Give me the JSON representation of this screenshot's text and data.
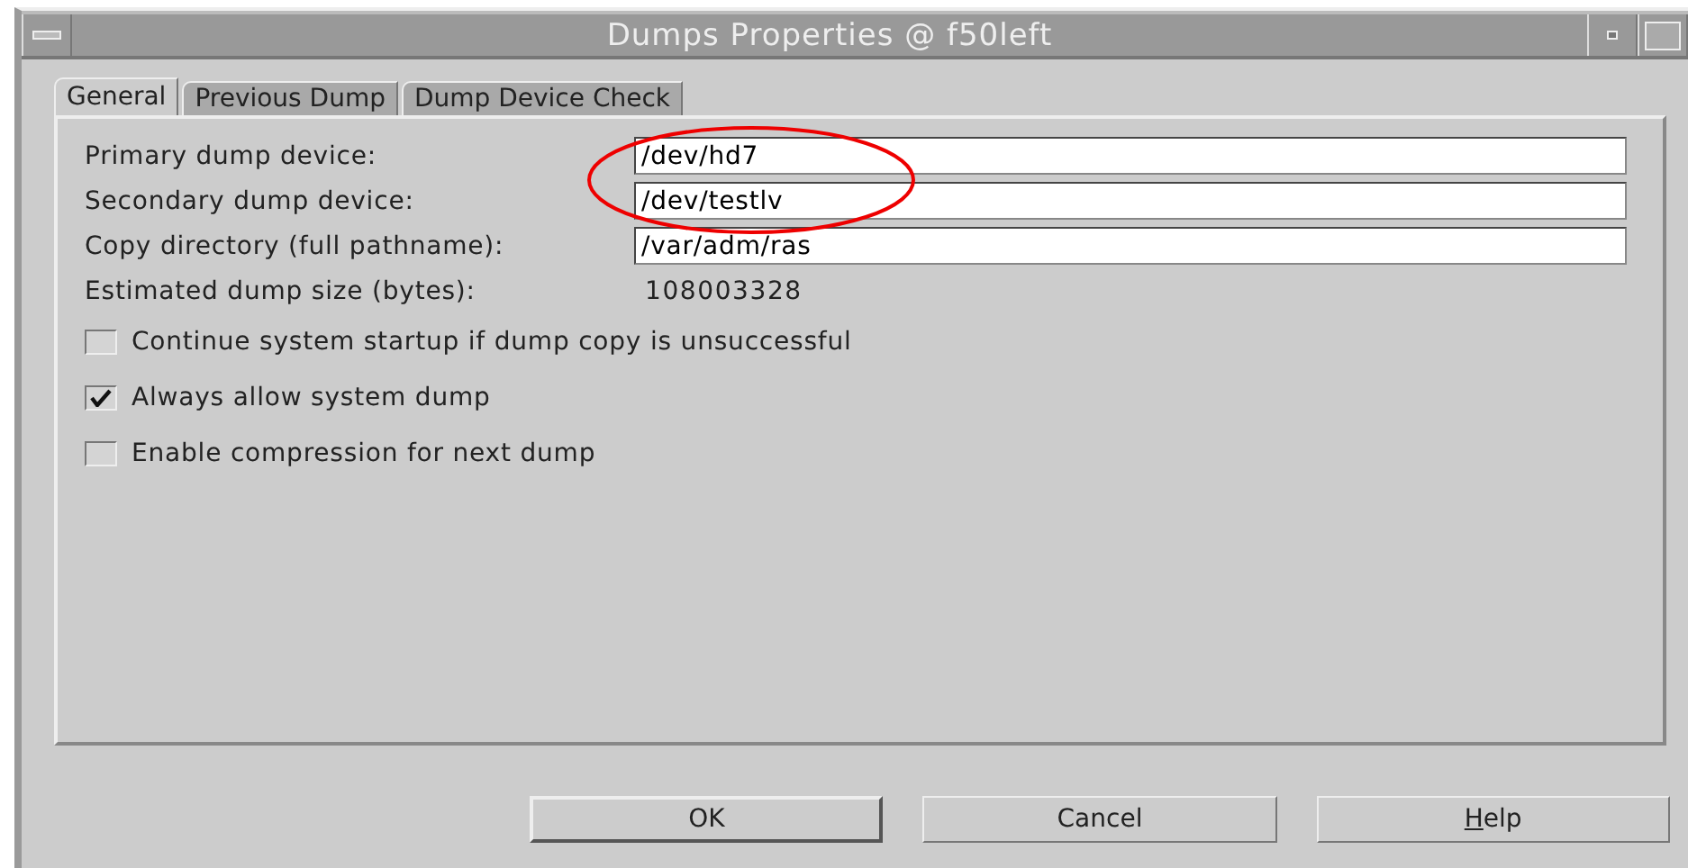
{
  "window": {
    "title": "Dumps  Properties @ f50left"
  },
  "tabs": [
    {
      "label": "General",
      "selected": true
    },
    {
      "label": "Previous Dump",
      "selected": false
    },
    {
      "label": "Dump Device Check",
      "selected": false
    }
  ],
  "fields": [
    {
      "kind": "input",
      "label": "Primary dump device:",
      "value": "/dev/hd7"
    },
    {
      "kind": "input",
      "label": "Secondary dump device:",
      "value": "/dev/testlv"
    },
    {
      "kind": "input",
      "label": "Copy directory (full pathname):",
      "value": "/var/adm/ras"
    },
    {
      "kind": "readout",
      "label": "Estimated dump size (bytes):",
      "value": "108003328"
    }
  ],
  "checkboxes": [
    {
      "label": "Continue system startup if dump copy is unsuccessful",
      "checked": false
    },
    {
      "label": "Always allow system dump",
      "checked": true
    },
    {
      "label": "Enable compression for next dump",
      "checked": false
    }
  ],
  "buttons": [
    {
      "label": "OK",
      "default": true,
      "mnemonic": false
    },
    {
      "label": "Cancel",
      "default": false,
      "mnemonic": false
    },
    {
      "label": "Help",
      "default": false,
      "mnemonic": true
    }
  ]
}
